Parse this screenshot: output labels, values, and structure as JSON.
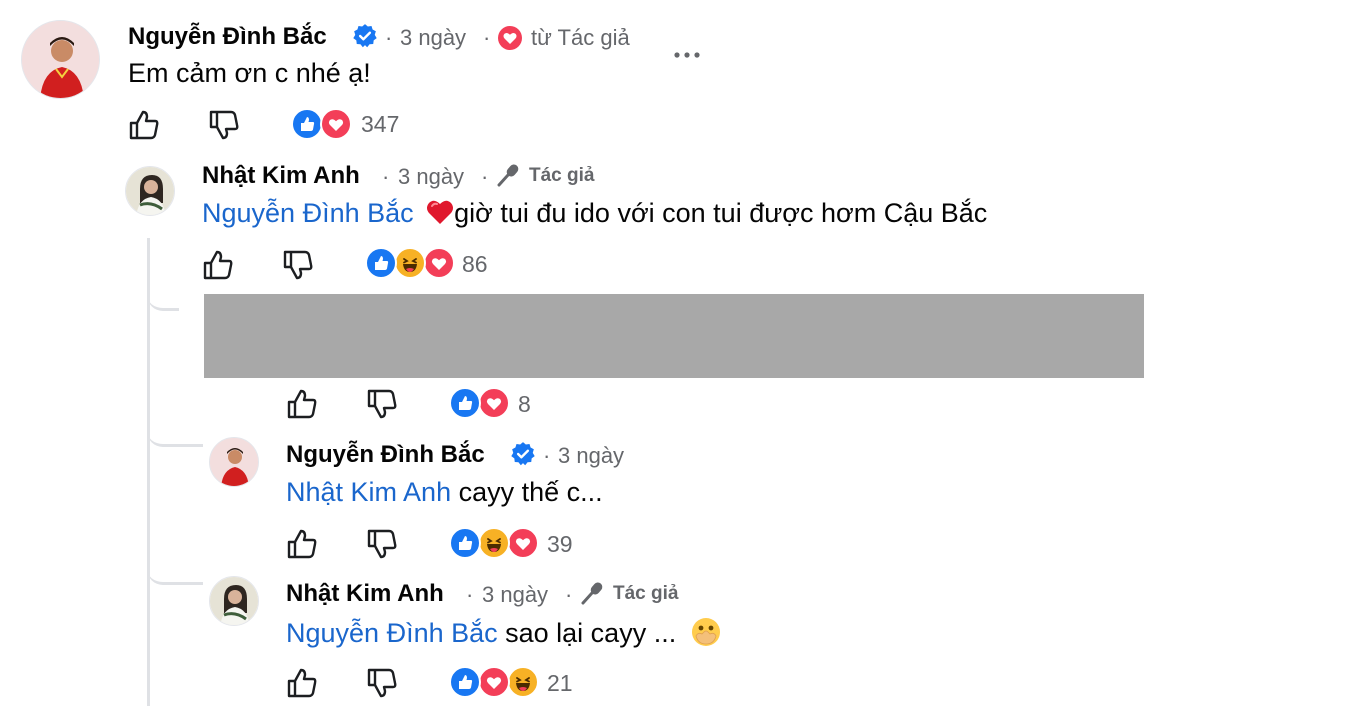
{
  "comments": [
    {
      "author": "Nguyễn Đình Bắc",
      "time": "3 ngày",
      "loved_by": "từ Tác giả",
      "text": "Em cảm ơn c nhé ạ!",
      "reaction_count": "347"
    },
    {
      "author": "Nhật Kim Anh",
      "time": "3 ngày",
      "badge": "Tác giả",
      "mention": "Nguyễn Đình Bắc",
      "text": "giờ tui đu ido với con tui được hơm Cậu Bắc",
      "reaction_count": "86"
    },
    {
      "redacted": true,
      "reaction_count": "8"
    },
    {
      "author": "Nguyễn Đình Bắc",
      "time": "3 ngày",
      "mention": "Nhật Kim Anh",
      "text": " cayy thế c...",
      "reaction_count": "39"
    },
    {
      "author": "Nhật Kim Anh",
      "time": "3 ngày",
      "badge": "Tác giả",
      "mention": "Nguyễn Đình Bắc",
      "text": " sao lại cayy ...",
      "reaction_count": "21"
    }
  ],
  "separator": "·",
  "more_icon": "more-options-icon",
  "colors": {
    "mention": "#1a66cc",
    "like": "#1877f2",
    "love": "#f33e58",
    "haha": "#f7b125",
    "verified": "#1877f2"
  }
}
